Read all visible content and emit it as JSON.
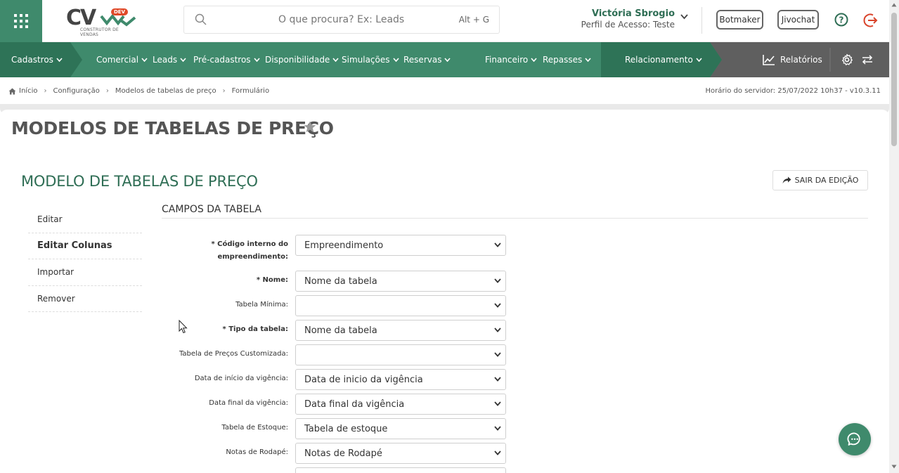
{
  "header": {
    "logo_text": "CV",
    "logo_badge": "DEV",
    "logo_subtitle": "CONSTRUTOR DE VENDAS",
    "search_placeholder": "O que procura? Ex: Leads",
    "search_shortcut": "Alt + G",
    "user_name": "Victória Sbrogio",
    "user_profile": "Perfil de Acesso: Teste",
    "botmaker_label": "Botmaker",
    "jivochat_label": "Jivochat",
    "icons": [
      "apps-grid-icon",
      "search-icon",
      "chevron-down-icon",
      "help-icon",
      "logout-icon"
    ]
  },
  "nav": {
    "items": [
      {
        "label": "Cadastros"
      },
      {
        "label": "Comercial"
      },
      {
        "label": "Leads"
      },
      {
        "label": "Pré-cadastros"
      },
      {
        "label": "Disponibilidade"
      },
      {
        "label": "Simulações"
      },
      {
        "label": "Reservas"
      },
      {
        "label": "Financeiro"
      },
      {
        "label": "Repasses"
      },
      {
        "label": "Relacionamento"
      }
    ],
    "reports_label": "Relatórios",
    "colors": {
      "primary": "#3f8a6c",
      "dark": "#2e6f56",
      "gray": "#5f5f5f"
    }
  },
  "breadcrumb": {
    "items": [
      "Início",
      "Configuração",
      "Modelos de tabelas de preço",
      "Formulário"
    ],
    "server_time": "Horário do servidor: 25/07/2022 10h37 - v10.3.11"
  },
  "page": {
    "title": "MODELOS DE TABELAS DE PREÇO",
    "section_title": "MODELO DE TABELAS DE PREÇO",
    "exit_label": "SAIR DA EDIÇÃO"
  },
  "side_menu": {
    "items": [
      {
        "label": "Editar"
      },
      {
        "label": "Editar Colunas"
      },
      {
        "label": "Importar"
      },
      {
        "label": "Remover"
      }
    ],
    "active_index": 1
  },
  "form": {
    "section_label": "CAMPOS DA TABELA",
    "fields": [
      {
        "label_line1": "* Código interno do",
        "label_line2": "empreendimento:",
        "value": "Empreendimento",
        "required": true
      },
      {
        "label": "* Nome:",
        "value": "Nome da tabela",
        "required": true
      },
      {
        "label": "Tabela Mínima:",
        "value": "",
        "required": false
      },
      {
        "label": "* Tipo da tabela:",
        "value": "Nome da tabela",
        "required": true
      },
      {
        "label": "Tabela de Preços Customizada:",
        "value": "",
        "required": false
      },
      {
        "label": "Data de início da vigência:",
        "value": "Data de inicio da vigência",
        "required": false
      },
      {
        "label": "Data final da vigência:",
        "value": "Data final da vigência",
        "required": false
      },
      {
        "label": "Tabela de Estoque:",
        "value": "Tabela de estoque",
        "required": false
      },
      {
        "label": "Notas de Rodapé:",
        "value": "Notas de Rodapé",
        "required": false
      }
    ]
  }
}
